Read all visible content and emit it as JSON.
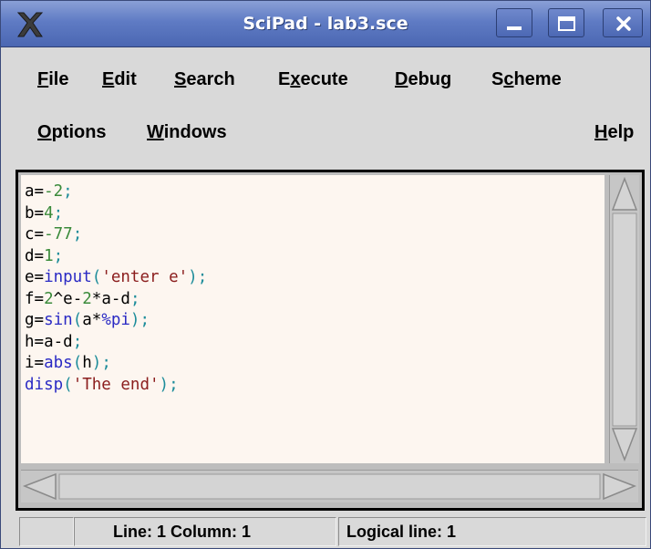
{
  "window": {
    "title": "SciPad - lab3.sce",
    "app_icon": "scilab-x-icon",
    "controls": [
      "minimize-icon",
      "maximize-icon",
      "close-icon"
    ]
  },
  "menu": {
    "file": {
      "mn": "F",
      "rest": "ile"
    },
    "edit": {
      "mn": "E",
      "rest": "dit"
    },
    "search": {
      "mn": "S",
      "rest": "earch"
    },
    "execute": {
      "pre": "E",
      "mn": "x",
      "rest": "ecute"
    },
    "debug": {
      "mn": "D",
      "rest": "ebug"
    },
    "scheme": {
      "pre": "S",
      "mn": "c",
      "rest": "heme"
    },
    "options": {
      "mn": "O",
      "rest": "ptions"
    },
    "windows": {
      "mn": "W",
      "rest": "indows"
    },
    "help": {
      "mn": "H",
      "rest": "elp"
    }
  },
  "code": [
    {
      "t1": "a=",
      "n1": "-2",
      "s1": ";"
    },
    {
      "t1": "b=",
      "n1": "4",
      "s1": ";"
    },
    {
      "t1": "c=",
      "n1": "-77",
      "s1": ";"
    },
    {
      "t1": "d=",
      "n1": "1",
      "s1": ";"
    },
    {
      "t1": "e=",
      "f1": "input",
      "p1": "(",
      "str": "'enter e'",
      "p2": ")",
      "s1": ";"
    },
    {
      "t1": "f=",
      "n1": "2",
      "t2": "^e-",
      "n2": "2",
      "t3": "*a-d",
      "s1": ";"
    },
    {
      "t1": "g=",
      "f1": "sin",
      "p1": "(",
      "t2": "a*",
      "f2": "%pi",
      "p2": ")",
      "s1": ";"
    },
    {
      "t1": "h=a-d",
      "s1": ";"
    },
    {
      "t1": "i=",
      "f1": "abs",
      "p1": "(",
      "t2": "h",
      "p2": ")",
      "s1": ";"
    },
    {
      "f1": "disp",
      "p1": "(",
      "str": "'The end'",
      "p2": ")",
      "s1": ";"
    }
  ],
  "status": {
    "line_column": "Line: 1 Column: 1",
    "logical_line": "Logical line: 1"
  },
  "colors": {
    "titlebar": "#5f7bc4",
    "editor_bg": "#fdf6f0",
    "number": "#3a8a3a",
    "function": "#2a2ac4",
    "string": "#8b1d1d",
    "separator": "#1c8c9a"
  }
}
